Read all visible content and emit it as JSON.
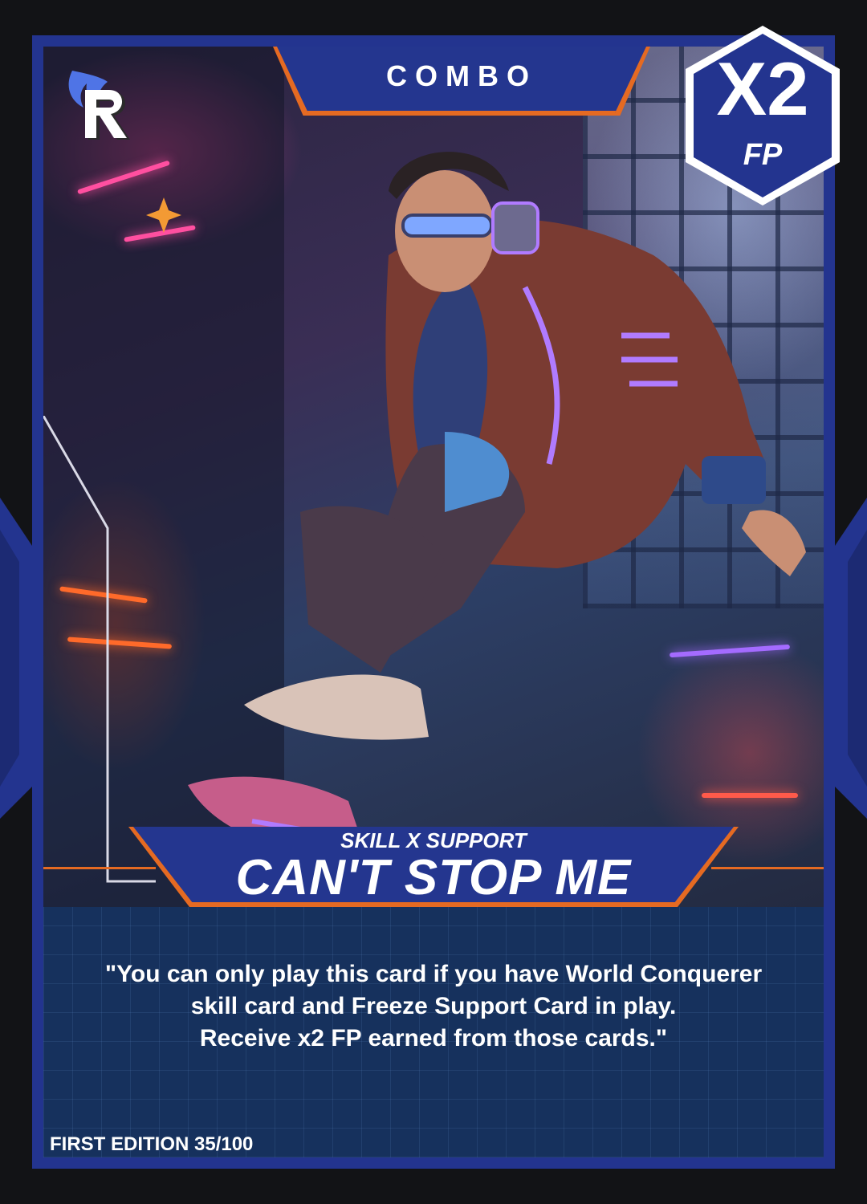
{
  "card": {
    "type_label": "COMBO",
    "multiplier": "X2",
    "multiplier_unit": "FP",
    "category": "SKILL X SUPPORT",
    "name": "CAN'T STOP ME",
    "description": "\"You can only play this card if you have World Conquerer\nskill card and Freeze Support Card in play.\nReceive x2 FP earned from those cards.\"",
    "edition": "FIRST EDITION 35/100"
  },
  "colors": {
    "frame": "#23348f",
    "accent": "#e56a22",
    "panel": "#16315d",
    "background": "#121316"
  },
  "icons": {
    "logo": "flame-r-logo-icon",
    "artwork": "cyberpunk-jumping-character-artwork"
  }
}
